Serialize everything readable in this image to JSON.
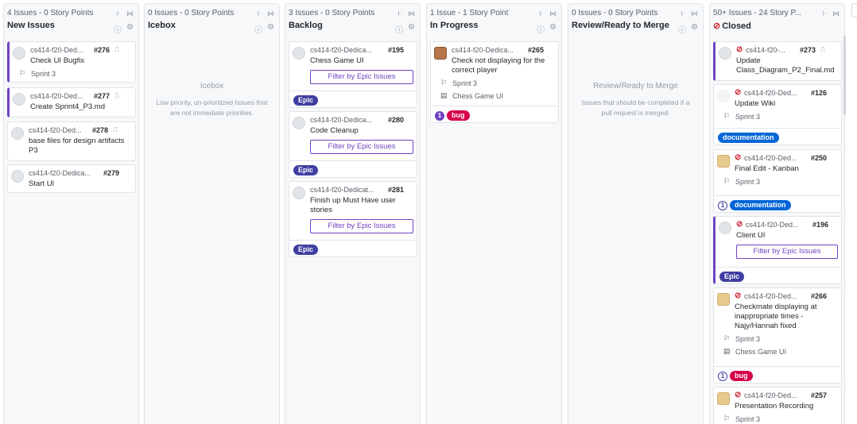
{
  "columns": [
    {
      "meta": "4 Issues - 0 Story Points",
      "title": "New Issues",
      "cards": [
        {
          "repo": "cs414-f20-Ded...",
          "number": "#276",
          "title": "Check UI Bugfix",
          "sprint": "Sprint 3"
        },
        {
          "repo": "cs414-f20-Ded...",
          "number": "#277",
          "title": "Create Sprint4_P3.md"
        },
        {
          "repo": "cs414-f20-Ded...",
          "number": "#278",
          "title": "base files for design artifacts P3"
        },
        {
          "repo": "cs414-f20-Dedica...",
          "number": "#279",
          "title": "Start UI"
        }
      ]
    },
    {
      "meta": "0 Issues - 0 Story Points",
      "title": "Icebox",
      "empty_title": "Icebox",
      "empty_desc": "Low priority, un-prioritized Issues that are not immediate priorities."
    },
    {
      "meta": "3 Issues - 0 Story Points",
      "title": "Backlog",
      "cards": [
        {
          "repo": "cs414-f20-Dedica...",
          "number": "#195",
          "title": "Chess Game UI",
          "button": "Filter by Epic Issues",
          "label": "Epic"
        },
        {
          "repo": "cs414-f20-Dedica...",
          "number": "#280",
          "title": "Code Cleanup",
          "button": "Filter by Epic Issues",
          "label": "Epic"
        },
        {
          "repo": "cs414-f20-Dedicat...",
          "number": "#281",
          "title": "Finish up Must Have user stories",
          "button": "Filter by Epic Issues",
          "label": "Epic"
        }
      ]
    },
    {
      "meta": "1 Issue - 1 Story Point",
      "title": "In Progress",
      "cards": [
        {
          "repo": "cs414-f20-Dedica...",
          "number": "#265",
          "title": "Check not displaying for the correct player",
          "sprint": "Sprint 3",
          "epic": "Chess Game UI",
          "count": "1",
          "label": "bug"
        }
      ]
    },
    {
      "meta": "0 Issues - 0 Story Points",
      "title": "Review/Ready to Merge",
      "empty_title": "Review/Ready to Merge",
      "empty_desc": "Issues that should be completed if a pull request is merged."
    },
    {
      "meta": "50+ Issues - 24 Story P...",
      "title": "Closed",
      "cards": [
        {
          "repo": "cs414-f20-...",
          "number": "#273",
          "title": "Update Class_Diagram_P2_Final.md"
        },
        {
          "repo": "cs414-f20-Ded...",
          "number": "#126",
          "title": "Update Wiki",
          "sprint": "Sprint 3",
          "label": "documentation"
        },
        {
          "repo": "cs414-f20-Ded...",
          "number": "#250",
          "title": "Final Edit - Kanban",
          "sprint": "Sprint 3",
          "count": "1",
          "label": "documentation"
        },
        {
          "repo": "cs414-f20-Ded...",
          "number": "#196",
          "title": "Client UI",
          "button": "Filter by Epic Issues",
          "label": "Epic"
        },
        {
          "repo": "cs414-f20-Ded...",
          "number": "#266",
          "title": "Checkmate displaying at inappropriate times - Najy/Hannah fixed",
          "sprint": "Sprint 3",
          "epic": "Chess Game UI",
          "count": "1",
          "label": "bug"
        },
        {
          "repo": "cs414-f20-Ded...",
          "number": "#257",
          "title": "Presentation Recording",
          "sprint": "Sprint 3"
        }
      ]
    }
  ],
  "icons": {
    "collapse": "collapse-icon",
    "expand": "expand-icon",
    "info": "info-icon",
    "settings": "gear-icon",
    "sprint": "milestone-icon",
    "epic": "epic-icon",
    "closed": "closed-issue-icon",
    "pr": "pull-request-icon"
  },
  "colors": {
    "epic": "#3f3ea2",
    "bug": "#d6004b",
    "documentation": "#0366d6",
    "accent": "#6f42c1",
    "closed": "#cb2431"
  }
}
